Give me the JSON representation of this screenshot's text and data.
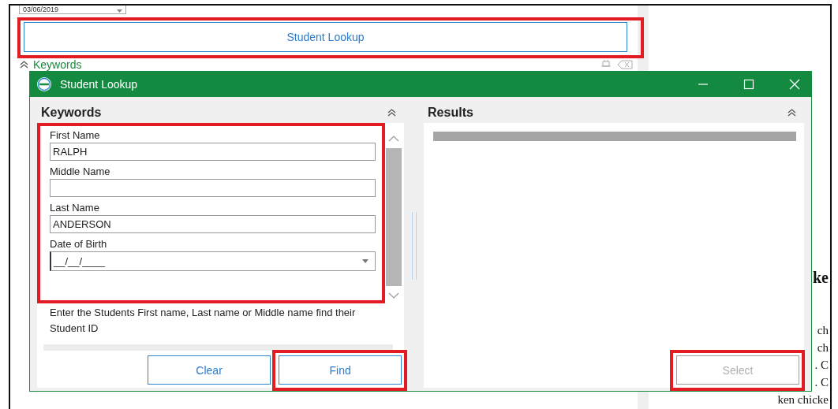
{
  "background": {
    "date_value": "03/06/2019",
    "lookup_button": {
      "label": "Student Lookup",
      "highlighted": true
    },
    "section_title": "Keywords",
    "document_fragments": [
      {
        "text": "ke",
        "kind": "heading"
      },
      {
        "text": "ch",
        "kind": "line"
      },
      {
        "text": "ch",
        "kind": "line"
      },
      {
        "text": ". C",
        "kind": "line"
      },
      {
        "text": ". C",
        "kind": "line"
      },
      {
        "text": "ken chicke",
        "kind": "line"
      }
    ]
  },
  "dialog": {
    "title": "Student Lookup",
    "keywords_panel": {
      "title": "Keywords",
      "fields_highlighted": true,
      "fields": [
        {
          "label": "First Name",
          "value": "RALPH",
          "kind": "text"
        },
        {
          "label": "Middle Name",
          "kind": "text"
        },
        {
          "label": "Last Name",
          "value": "ANDERSON",
          "kind": "text"
        },
        {
          "label": "Date of Birth",
          "value": "__/__/____",
          "kind": "date"
        }
      ],
      "hint": "Enter the Students First name, Last name or Middle name find their Student ID",
      "buttons": [
        {
          "label": "Clear",
          "highlighted": false
        },
        {
          "label": "Find",
          "highlighted": true
        }
      ]
    },
    "results_panel": {
      "title": "Results",
      "select_button": {
        "label": "Select",
        "disabled": true,
        "highlighted": true
      }
    }
  }
}
